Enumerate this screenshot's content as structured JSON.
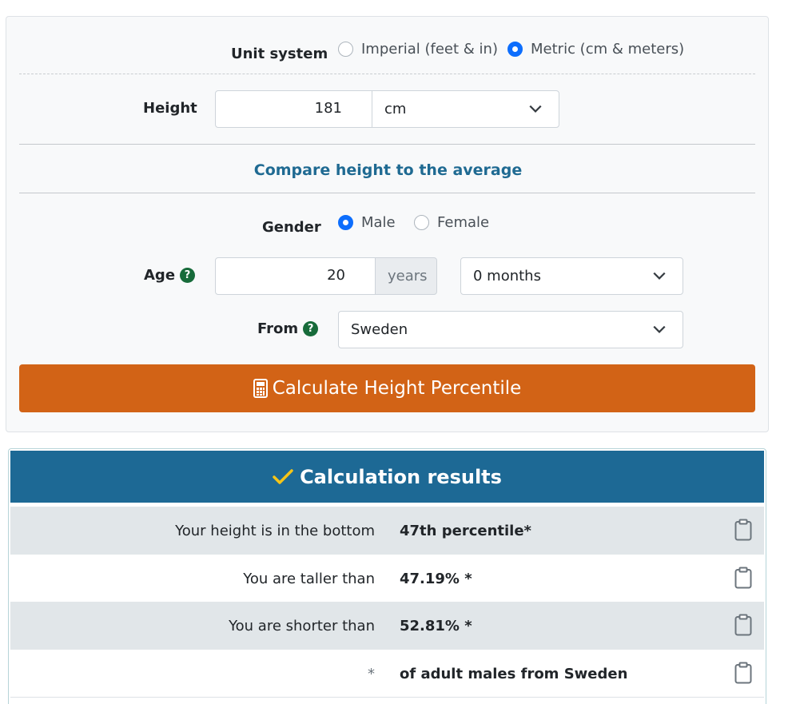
{
  "form": {
    "unit_system_label": "Unit system",
    "unit_options": [
      {
        "label": "Imperial (feet & in)",
        "selected": false
      },
      {
        "label": "Metric (cm & meters)",
        "selected": true
      }
    ],
    "height_label": "Height",
    "height_value": "181",
    "height_unit": "cm",
    "section_title": "Compare height to the average",
    "gender_label": "Gender",
    "gender_options": [
      {
        "label": "Male",
        "selected": true
      },
      {
        "label": "Female",
        "selected": false
      }
    ],
    "age_label": "Age",
    "age_value": "20",
    "age_unit": "years",
    "age_months": "0 months",
    "from_label": "From",
    "from_value": "Sweden",
    "help_glyph": "?",
    "calculate_label": "Calculate Height Percentile",
    "calculate_icon": "calculator-icon"
  },
  "results": {
    "title": "Calculation results",
    "title_icon": "checkmark-icon",
    "rows": [
      {
        "label": "Your height is in the bottom",
        "value": "47th percentile*"
      },
      {
        "label": "You are taller than",
        "value": "47.19% *"
      },
      {
        "label": "You are shorter than",
        "value": "52.81% *"
      },
      {
        "label": "*",
        "value": "of adult males from Sweden"
      }
    ],
    "copy_icon": "clipboard-icon"
  },
  "colors": {
    "accent_blue": "#0d6efd",
    "button_orange": "#d26316",
    "results_header": "#1d6995",
    "section_title": "#1f6a92",
    "help_green": "#176b3a",
    "check_yellow": "#f5c518"
  }
}
